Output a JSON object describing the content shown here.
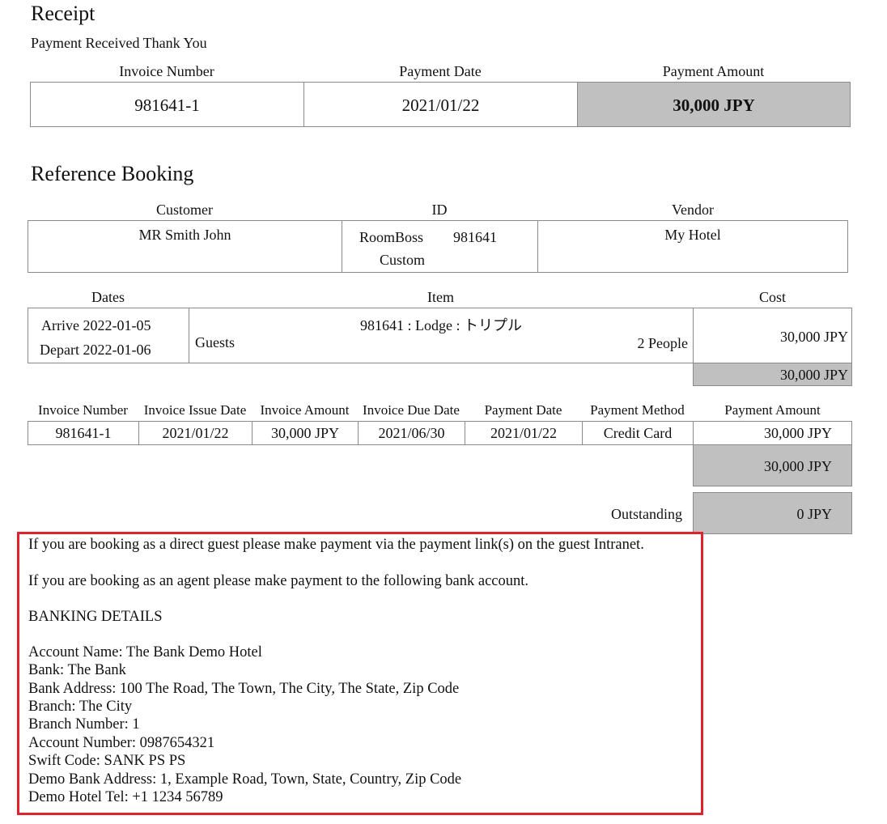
{
  "receipt": {
    "title": "Receipt",
    "subtitle": "Payment Received Thank You",
    "headers": [
      "Invoice Number",
      "Payment Date",
      "Payment Amount"
    ],
    "values": [
      "981641-1",
      "2021/01/22",
      "30,000 JPY"
    ]
  },
  "reference": {
    "title": "Reference Booking",
    "headers": [
      "Customer",
      "ID",
      "Vendor"
    ],
    "customer": "MR Smith John",
    "id_source": "RoomBoss",
    "id_number": "981641",
    "id_type": "Custom",
    "vendor": "My Hotel"
  },
  "items": {
    "headers": [
      "Dates",
      "Item",
      "Cost"
    ],
    "arrive": "Arrive 2022-01-05",
    "depart": "Depart 2022-01-06",
    "item_title": "981641 : Lodge : トリプル",
    "guests_label": "Guests",
    "guests_value": "2 People",
    "cost": "30,000 JPY",
    "cost_total": "30,000 JPY"
  },
  "invoice": {
    "headers": [
      "Invoice Number",
      "Invoice Issue Date",
      "Invoice Amount",
      "Invoice Due Date",
      "Payment Date",
      "Payment Method",
      "Payment Amount"
    ],
    "row": [
      "981641-1",
      "2021/01/22",
      "30,000 JPY",
      "2021/06/30",
      "2021/01/22",
      "Credit Card",
      "30,000 JPY"
    ],
    "total": "30,000 JPY",
    "outstanding_label": "Outstanding",
    "outstanding_value": "0 JPY"
  },
  "notice": {
    "direct": "If you are booking as a direct guest please make payment via the payment link(s) on the guest Intranet.",
    "agent": "If you are booking as an agent please make payment to the following bank account.",
    "banking_title": "BANKING DETAILS",
    "details": [
      "Account Name: The Bank Demo Hotel",
      "Bank: The Bank",
      "Bank Address: 100 The Road, The Town, The City, The State, Zip Code",
      "Branch: The City",
      "Branch Number: 1",
      "Account Number: 0987654321",
      "Swift Code: SANK PS PS",
      "Demo Bank Address: 1, Example Road, Town, State, Country, Zip Code",
      "Demo Hotel Tel: +1 1234 56789"
    ]
  },
  "colors": {
    "highlight_border": "#e0212e",
    "cell_shade": "#c0c0c0"
  }
}
